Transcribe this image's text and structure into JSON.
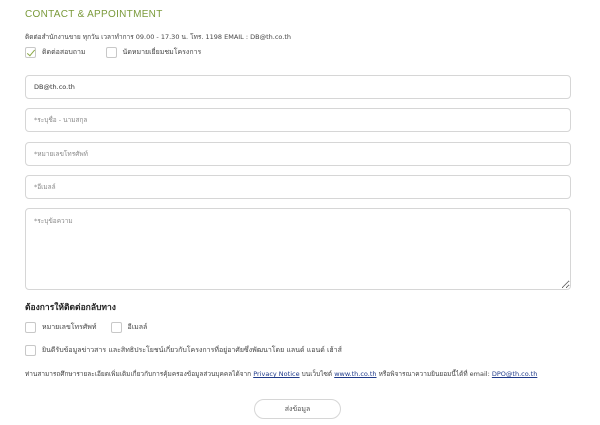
{
  "form": {
    "title": "CONTACT & APPOINTMENT",
    "info_line": "ติดต่อสำนักงานขาย ทุกวัน เวลาทำการ 09.00 - 17.30 น. โทร. 1198 EMAIL : DB@th.co.th",
    "inquiry_options": [
      {
        "label": "ติดต่อสอบถาม",
        "checked": true
      },
      {
        "label": "นัดหมายเยี่ยมชมโครงการ",
        "checked": false
      }
    ],
    "email_value": "DB@th.co.th",
    "name_placeholder": "*ระบุชื่อ - นามสกุล",
    "phone_placeholder": "*หมายเลขโทรศัพท์",
    "email2_placeholder": "*อีเมลล์",
    "message_placeholder": "*ระบุข้อความ",
    "contact_back_title": "ต้องการให้ติดต่อกลับทาง",
    "contact_back_options": [
      {
        "label": "หมายเลขโทรศัพท์",
        "checked": false
      },
      {
        "label": "อีเมลล์",
        "checked": false
      }
    ],
    "consent_label": "ยินดีรับข้อมูลข่าวสาร และสิทธิประโยชน์เกี่ยวกับโครงการที่อยู่อาศัยซึ่งพัฒนาโดย แลนด์ แอนด์ เฮ้าส์",
    "notice": {
      "prefix": "ท่านสามารถศึกษารายละเอียดเพิ่มเติมเกี่ยวกับการคุ้มครองข้อมูลส่วนบุคคลได้จาก",
      "privacy_link": "Privacy Notice",
      "middle": "บนเว็บไซต์",
      "website_link": "www.th.co.th",
      "suffix": "หรือพิจารณาความยินยอมนี้ได้ที่ email:",
      "dpo_link": "DPO@th.co.th"
    },
    "submit_label": "ส่งข้อมูล"
  }
}
